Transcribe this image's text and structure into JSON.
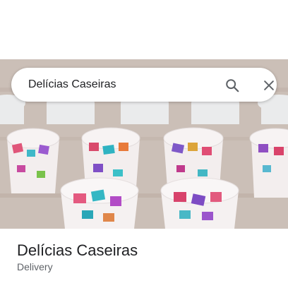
{
  "search": {
    "query": "Delícias Caseiras"
  },
  "place": {
    "name": "Delícias Caseiras",
    "category": "Delivery"
  },
  "icons": {
    "search": "search-icon",
    "close": "close-icon"
  },
  "colors": {
    "text_primary": "#202124",
    "text_secondary": "#5f6368",
    "icon": "#5f6368"
  }
}
